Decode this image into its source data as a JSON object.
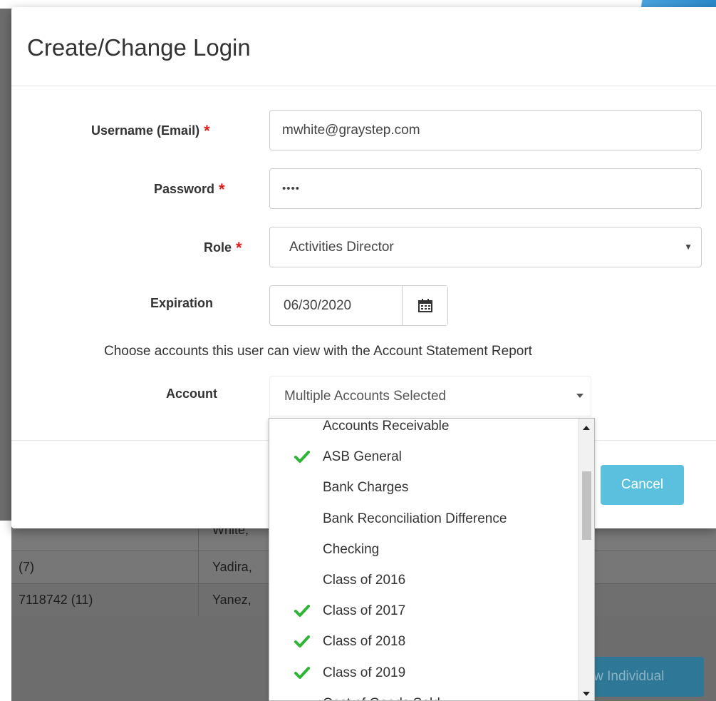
{
  "modal": {
    "title": "Create/Change Login"
  },
  "form": {
    "username_label": "Username (Email)",
    "username_value": "mwhite@graystep.com",
    "password_label": "Password",
    "password_value": "••••",
    "role_label": "Role",
    "role_value": "Activities Director",
    "expiration_label": "Expiration",
    "expiration_value": "06/30/2020",
    "required_mark": "*",
    "accounts_note": "Choose accounts this user can view with the Account Statement Report",
    "account_label": "Account",
    "account_value": "Multiple Accounts Selected"
  },
  "buttons": {
    "cancel": "Cancel",
    "view_individual": "View Individual"
  },
  "account_options": [
    {
      "label": "Accounts Receivable",
      "checked": false
    },
    {
      "label": "ASB General",
      "checked": true
    },
    {
      "label": "Bank Charges",
      "checked": false
    },
    {
      "label": "Bank Reconciliation Difference",
      "checked": false
    },
    {
      "label": "Checking",
      "checked": false
    },
    {
      "label": "Class of 2016",
      "checked": false
    },
    {
      "label": "Class of 2017",
      "checked": true
    },
    {
      "label": "Class of 2018",
      "checked": true
    },
    {
      "label": "Class of 2019",
      "checked": true
    },
    {
      "label": "Cost of Goods Sold",
      "checked": false
    }
  ],
  "background_table": {
    "rows": [
      {
        "id": "",
        "name": "White, "
      },
      {
        "id": "(7)",
        "name": "Yadira, "
      },
      {
        "id": "7118742 (11)",
        "name": "Yanez, "
      }
    ]
  },
  "colors": {
    "required": "#e21b1b",
    "check": "#2fb536",
    "cancel_button": "#5bc0de"
  },
  "icons": {
    "calendar": "calendar-icon",
    "check": "checkmark-icon",
    "caret": "caret-down-icon"
  }
}
